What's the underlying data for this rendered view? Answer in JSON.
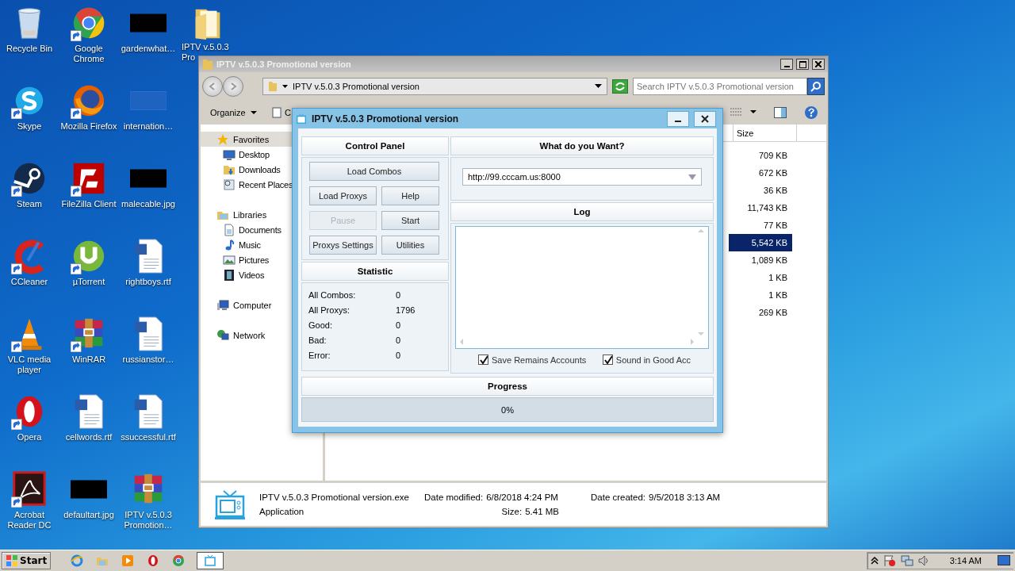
{
  "desktop_icons": [
    {
      "label": "Recycle Bin",
      "kind": "recycle-bin",
      "shortcut": false
    },
    {
      "label": "Skype",
      "kind": "skype",
      "shortcut": true
    },
    {
      "label": "Steam",
      "kind": "steam",
      "shortcut": true
    },
    {
      "label": "CCleaner",
      "kind": "ccleaner",
      "shortcut": true
    },
    {
      "label": "VLC media player",
      "kind": "vlc",
      "shortcut": true
    },
    {
      "label": "Opera",
      "kind": "opera",
      "shortcut": true
    },
    {
      "label": "Acrobat Reader DC",
      "kind": "acrobat",
      "shortcut": true
    },
    {
      "label": "Google Chrome",
      "kind": "chrome",
      "shortcut": true
    },
    {
      "label": "Mozilla Firefox",
      "kind": "firefox",
      "shortcut": true
    },
    {
      "label": "FileZilla Client",
      "kind": "filezilla",
      "shortcut": true
    },
    {
      "label": "µTorrent",
      "kind": "utorrent",
      "shortcut": true
    },
    {
      "label": "WinRAR",
      "kind": "winrar",
      "shortcut": true
    },
    {
      "label": "cellwords.rtf",
      "kind": "word",
      "shortcut": false
    },
    {
      "label": "defaultart.jpg",
      "kind": "thumb-black",
      "shortcut": false
    },
    {
      "label": "gardenwhat…",
      "kind": "thumb-black",
      "shortcut": false
    },
    {
      "label": "internation…",
      "kind": "thumb-blue",
      "shortcut": false
    },
    {
      "label": "malecable.jpg",
      "kind": "thumb-black",
      "shortcut": false
    },
    {
      "label": "rightboys.rtf",
      "kind": "word",
      "shortcut": false
    },
    {
      "label": "russianstor…",
      "kind": "word",
      "shortcut": false
    },
    {
      "label": "ssuccessful.rtf",
      "kind": "word",
      "shortcut": false
    },
    {
      "label": "IPTV v.5.0.3 Promotion…",
      "kind": "winrar",
      "shortcut": false
    },
    {
      "label": "IPTV v.5.0.3 Pro",
      "kind": "folder",
      "shortcut": false
    }
  ],
  "explorer": {
    "title": "IPTV v.5.0.3 Promotional version",
    "address": "IPTV v.5.0.3 Promotional version",
    "search": {
      "placeholder": "Search IPTV v.5.0.3 Promotional version"
    },
    "toolbar": [
      "Organize",
      "C"
    ],
    "nav": [
      {
        "label": "Favorites",
        "kind": "star",
        "selected": true,
        "children": [
          {
            "label": "Desktop",
            "kind": "desktop",
            "selected": false
          },
          {
            "label": "Downloads",
            "kind": "downloads",
            "selected": false
          },
          {
            "label": "Recent Places",
            "kind": "recent",
            "selected": false
          }
        ]
      },
      {
        "label": "Libraries",
        "kind": "libraries",
        "selected": false,
        "children": [
          {
            "label": "Documents",
            "kind": "documents",
            "selected": false
          },
          {
            "label": "Music",
            "kind": "music",
            "selected": false
          },
          {
            "label": "Pictures",
            "kind": "pictures",
            "selected": false
          },
          {
            "label": "Videos",
            "kind": "videos",
            "selected": false
          }
        ]
      },
      {
        "label": "Computer",
        "kind": "computer",
        "selected": false
      },
      {
        "label": "Network",
        "kind": "network",
        "selected": false
      }
    ],
    "columns": [
      "Size"
    ],
    "rows": [
      {
        "size": "709 KB",
        "selected": false
      },
      {
        "size": "672 KB",
        "selected": false
      },
      {
        "size": "36 KB",
        "selected": false
      },
      {
        "size": "11,743 KB",
        "selected": false
      },
      {
        "size": "77 KB",
        "selected": false
      },
      {
        "size": "5,542 KB",
        "selected": true
      },
      {
        "size": "1,089 KB",
        "selected": false
      },
      {
        "size": "1 KB",
        "selected": false
      },
      {
        "size": "1 KB",
        "selected": false
      },
      {
        "size": "269 KB",
        "selected": false
      }
    ],
    "details": {
      "name": "IPTV v.5.0.3 Promotional version.exe",
      "type": "Application",
      "date_modified_label": "Date modified:",
      "date_modified": "6/8/2018 4:24 PM",
      "size_label": "Size:",
      "size": "5.41 MB",
      "date_created_label": "Date created:",
      "date_created": "9/5/2018 3:13 AM"
    }
  },
  "dialog": {
    "title": "IPTV v.5.0.3 Promotional version",
    "control_panel": {
      "title": "Control Panel",
      "buttons": [
        {
          "label": "Load Combos",
          "disabled": false
        },
        {
          "label": "Load Proxys",
          "disabled": false
        },
        {
          "label": "Help",
          "disabled": false
        },
        {
          "label": "Pause",
          "disabled": true
        },
        {
          "label": "Start",
          "disabled": false
        },
        {
          "label": "Proxys Settings",
          "disabled": false
        },
        {
          "label": "Utilities",
          "disabled": false
        }
      ]
    },
    "statistic": {
      "title": "Statistic",
      "rows": [
        {
          "label": "All Combos:",
          "value": "0"
        },
        {
          "label": "All Proxys:",
          "value": "1796"
        },
        {
          "label": "Good:",
          "value": "0"
        },
        {
          "label": "Bad:",
          "value": "0"
        },
        {
          "label": "Error:",
          "value": "0"
        }
      ]
    },
    "target": {
      "title": "What do you Want?",
      "value": "http://99.cccam.us:8000"
    },
    "log": {
      "title": "Log"
    },
    "options": [
      {
        "label": "Save Remains Accounts",
        "checked": true
      },
      {
        "label": "Sound in Good Acc",
        "checked": true
      }
    ],
    "progress": {
      "title": "Progress",
      "level": 0,
      "reading": "0%"
    }
  },
  "taskbar": {
    "start": "Start",
    "apps": [
      {
        "kind": "ie",
        "selected": false
      },
      {
        "kind": "explorer",
        "selected": false
      },
      {
        "kind": "media",
        "selected": false
      },
      {
        "kind": "opera",
        "selected": false
      },
      {
        "kind": "chrome",
        "selected": false
      },
      {
        "kind": "iptv",
        "selected": true
      }
    ],
    "clock": "3:14 AM"
  }
}
